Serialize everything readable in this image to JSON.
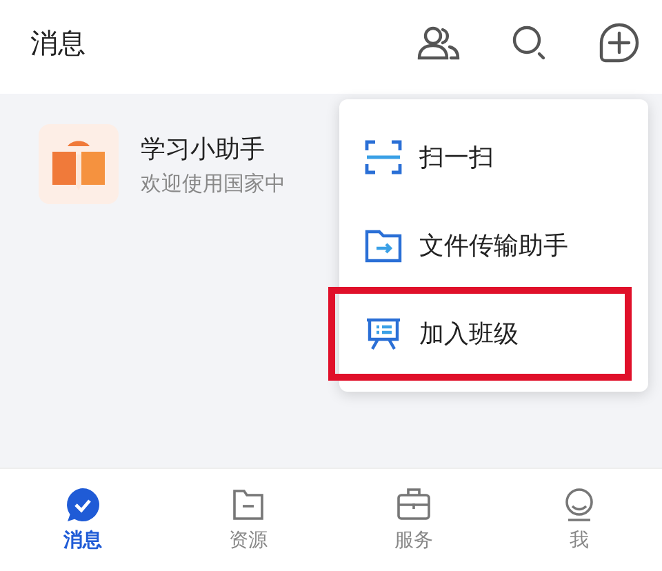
{
  "header": {
    "title": "消息"
  },
  "messages": [
    {
      "name": "学习小助手",
      "preview": "欢迎使用国家中"
    }
  ],
  "menu": {
    "items": [
      {
        "kind": "scan",
        "label": "扫一扫",
        "highlighted": false
      },
      {
        "kind": "file",
        "label": "文件传输助手",
        "highlighted": false
      },
      {
        "kind": "class",
        "label": "加入班级",
        "highlighted": true
      }
    ]
  },
  "tabs": [
    {
      "kind": "message",
      "label": "消息",
      "selected": true
    },
    {
      "kind": "resource",
      "label": "资源",
      "selected": false
    },
    {
      "kind": "service",
      "label": "服务",
      "selected": false
    },
    {
      "kind": "me",
      "label": "我",
      "selected": false
    }
  ]
}
